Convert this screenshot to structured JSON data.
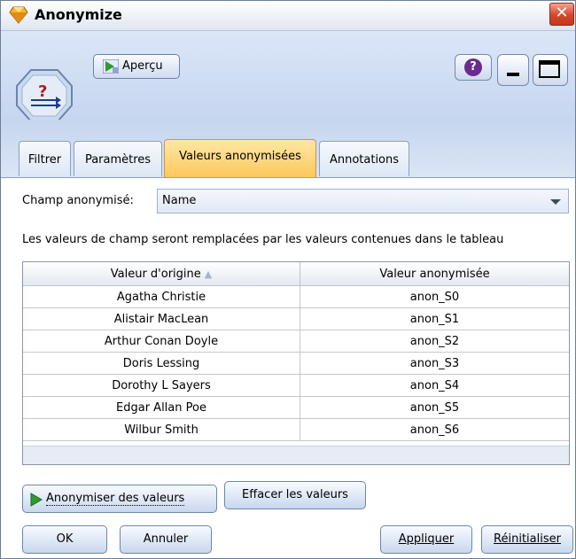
{
  "window": {
    "title": "Anonymize",
    "close_glyph": "✕"
  },
  "toolbar": {
    "preview_label": "Aperçu",
    "help_glyph": "?"
  },
  "tabs": [
    {
      "label": "Filtrer",
      "active": false
    },
    {
      "label": "Paramètres",
      "active": false
    },
    {
      "label": "Valeurs anonymisées",
      "active": true
    },
    {
      "label": "Annotations",
      "active": false
    }
  ],
  "field": {
    "label": "Champ anonymisé:",
    "selected": "Name"
  },
  "description": "Les valeurs de champ seront remplacées par les valeurs contenues dans le tableau",
  "table": {
    "columns": [
      "Valeur d'origine",
      "Valeur anonymisée"
    ],
    "sort_glyph": "▲",
    "rows": [
      [
        "Agatha Christie",
        "anon_S0"
      ],
      [
        "Alistair MacLean",
        "anon_S1"
      ],
      [
        "Arthur Conan Doyle",
        "anon_S2"
      ],
      [
        "Doris Lessing",
        "anon_S3"
      ],
      [
        "Dorothy L Sayers",
        "anon_S4"
      ],
      [
        "Edgar Allan Poe",
        "anon_S5"
      ],
      [
        "Wilbur Smith",
        "anon_S6"
      ]
    ]
  },
  "buttons": {
    "anonymize_label": "Anonymiser des valeurs",
    "clear_label": "Effacer les valeurs",
    "ok_label": "OK",
    "cancel_label": "Annuler",
    "apply_label": "Appliquer",
    "reset_label": "Réinitialiser"
  },
  "colors": {
    "active_tab": "#fcc75a",
    "close_button": "#d3462b",
    "play_green": "#2f9a2f"
  }
}
